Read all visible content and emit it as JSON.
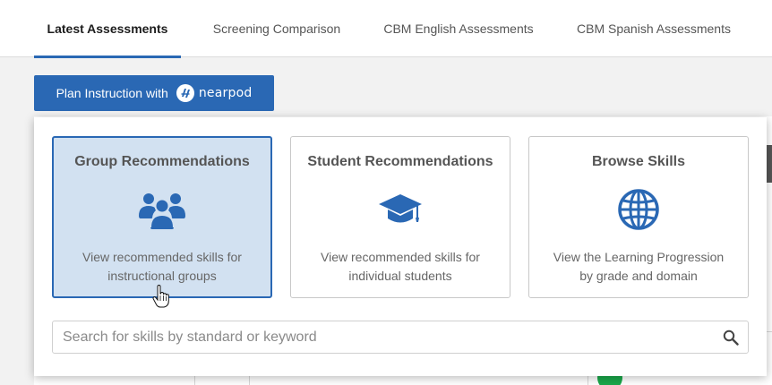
{
  "tabs": [
    {
      "label": "Latest Assessments",
      "active": true
    },
    {
      "label": "Screening Comparison",
      "active": false
    },
    {
      "label": "CBM English Assessments",
      "active": false
    },
    {
      "label": "CBM Spanish Assessments",
      "active": false
    }
  ],
  "plan_button": {
    "label": "Plan Instruction with",
    "brand": "nearpod"
  },
  "cards": [
    {
      "title": "Group Recommendations",
      "icon": "users-group-icon",
      "desc_line1": "View recommended skills for",
      "desc_line2": "instructional groups",
      "selected": true
    },
    {
      "title": "Student Recommendations",
      "icon": "graduation-cap-icon",
      "desc_line1": "View recommended skills for",
      "desc_line2": "individual students",
      "selected": false
    },
    {
      "title": "Browse Skills",
      "icon": "globe-icon",
      "desc_line1": "View the Learning Progression",
      "desc_line2": "by grade and domain",
      "selected": false
    }
  ],
  "search": {
    "placeholder": "Search for skills by standard or keyword",
    "value": ""
  },
  "colors": {
    "accent": "#2a68b4",
    "selected_bg": "#d2e1f1",
    "status_green": "#1aa84a"
  }
}
